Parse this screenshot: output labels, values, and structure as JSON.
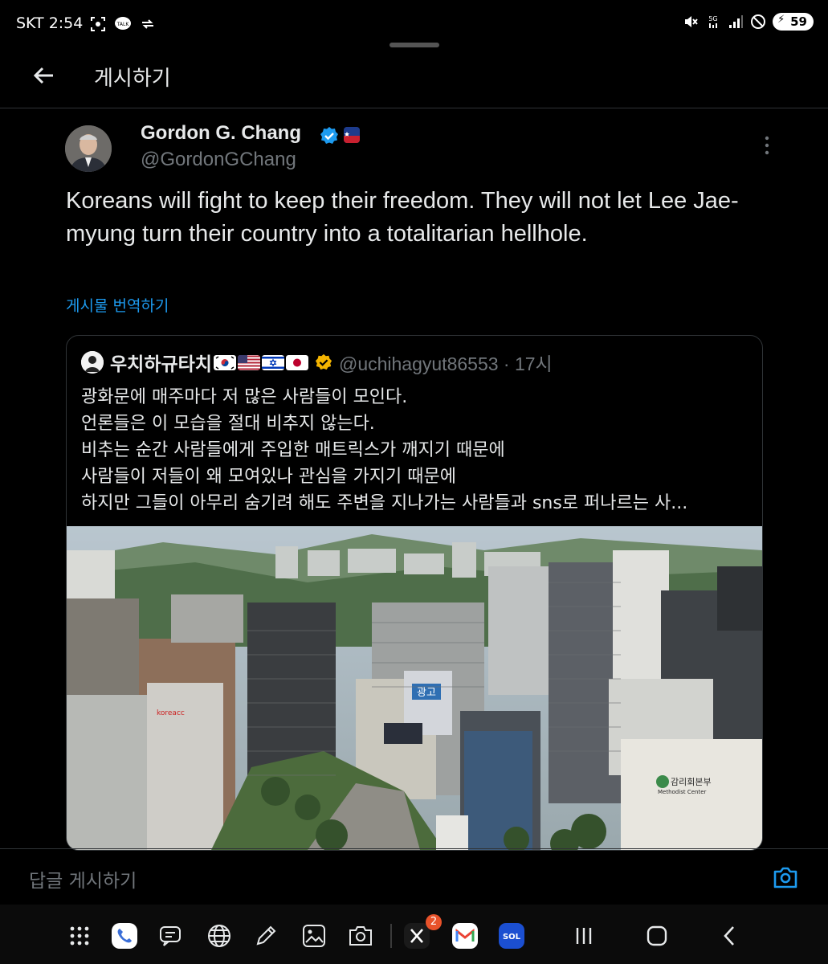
{
  "status_bar": {
    "carrier_time": "SKT 2:54",
    "network": "5G",
    "battery": "59"
  },
  "header": {
    "title": "게시하기"
  },
  "post": {
    "author_name": "Gordon G. Chang",
    "author_handle": "@GordonGChang",
    "text": "Koreans will fight to keep their freedom. They will not let Lee Jae-myung turn their country into a totalitarian hellhole.",
    "translate_link": "게시물 번역하기"
  },
  "quote": {
    "author_name": "우치하규타치",
    "handle_time": "@uchihagyut86553 · 17시",
    "lines": [
      "광화문에 매주마다 저 많은 사람들이 모인다.",
      "언론들은 이 모습을 절대 비추지 않는다.",
      "비추는 순간 사람들에게 주입한 매트릭스가 깨지기 때문에",
      "사람들이 저들이 왜 모여있나 관심을 가지기 때문에",
      "하지만 그들이 아무리 숨기려 해도 주변을 지나가는 사람들과 sns로 퍼나르는 사..."
    ],
    "image_signs": {
      "ad_sign": "광고",
      "sign_right": "감리회본부",
      "sign_right_sub": "Methodist Center",
      "sign_left": "koreacc"
    }
  },
  "reply_bar": {
    "placeholder": "답글 게시하기"
  },
  "dock": {
    "x_badge": "2",
    "sol_label": "SOL"
  },
  "colors": {
    "accent": "#1d9bf0",
    "background": "#000000",
    "muted": "#71767b"
  }
}
